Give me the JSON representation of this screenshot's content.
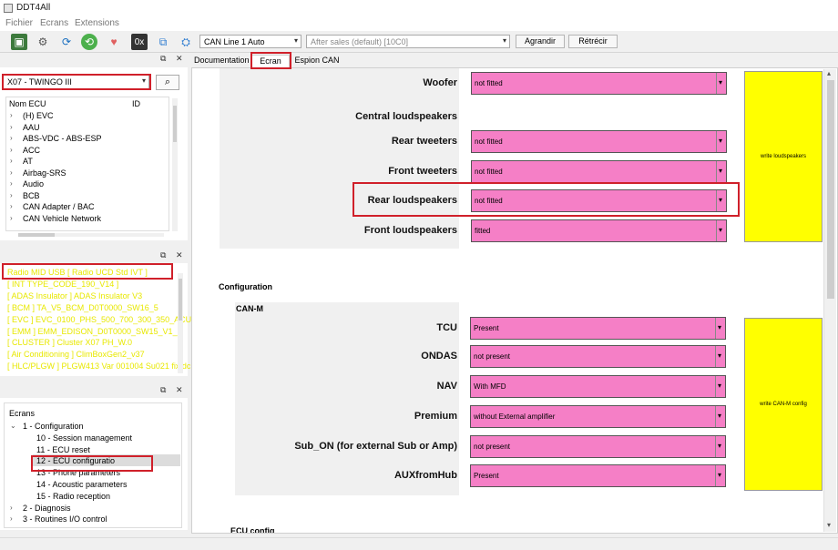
{
  "app": {
    "title": "DDT4All"
  },
  "menu": {
    "items": [
      "Fichier",
      "Ecrans",
      "Extensions"
    ]
  },
  "toolbar": {
    "can_line": "CAN Line 1 Auto",
    "session": "After sales (default) [10C0]",
    "zoom_in": "Agrandir",
    "zoom_out": "Rétrécir",
    "hex_label": "0x"
  },
  "vehicle": {
    "selected": "X07 - TWINGO III"
  },
  "ecu_list": {
    "col_name": "Nom ECU",
    "col_id": "ID",
    "items": [
      "(H) EVC",
      "AAU",
      "ABS-VDC - ABS-ESP",
      "ACC",
      "AT",
      "Airbag-SRS",
      "Audio",
      "BCB",
      "CAN Adapter / BAC",
      "CAN Vehicle Network"
    ]
  },
  "scanned": {
    "items": [
      "Radio MID USB [ Radio UCD Std IVT ]",
      "[ INT TYPE_CODE_190_V14 ]",
      "[ ADAS Insulator ] ADAS Insulator V3",
      "[ BCM ] TA_V5_BCM_D0T0000_SW16_5",
      "[ EVC ] EVC_0100_PHS_500_700_300_350_ACU_1",
      "[ EMM ] EMM_EDISON_D0T0000_SW15_V1_1",
      "[ CLUSTER ] Cluster X07 PH_W.0",
      "[ Air Conditioning ] ClimBoxGen2_v37",
      "[ HLC/PLGW ] PLGW413 Var 001004 Su021 fix dc"
    ]
  },
  "screens": {
    "header": "Ecrans",
    "groups": [
      {
        "label": "1 - Configuration",
        "children": [
          "10 - Session management",
          "11 - ECU reset",
          "12 - ECU configuratio",
          "13 - Phone parameters",
          "14 - Acoustic parameters",
          "15 - Radio reception"
        ]
      },
      {
        "label": "2 - Diagnosis"
      },
      {
        "label": "3 - Routines I/O control"
      }
    ]
  },
  "tabs": [
    "Documentation",
    "Ecran",
    "Espion CAN"
  ],
  "loudspeakers": {
    "rows": [
      {
        "label": "Woofer",
        "value": "not fitted"
      },
      {
        "label": "Central loudspeakers",
        "value": ""
      },
      {
        "label": "Rear tweeters",
        "value": "not fitted"
      },
      {
        "label": "Front tweeters",
        "value": "not fitted"
      },
      {
        "label": "Rear loudspeakers",
        "value": "not fitted"
      },
      {
        "label": "Front loudspeakers",
        "value": "fitted"
      }
    ],
    "write_button": "write loudspeakers"
  },
  "configuration": {
    "title": "Configuration",
    "canm_title": "CAN-M",
    "rows": [
      {
        "label": "TCU",
        "value": "Present"
      },
      {
        "label": "ONDAS",
        "value": "not present"
      },
      {
        "label": "NAV",
        "value": "With MFD"
      },
      {
        "label": "Premium",
        "value": "without External amplifier"
      },
      {
        "label": "Sub_ON (for external Sub or Amp)",
        "value": "not present"
      },
      {
        "label": "AUXfromHub",
        "value": "Present"
      }
    ],
    "write_button": "write CAN-M config",
    "next_section": "ECU config"
  },
  "colors": {
    "field": "#f57fc6",
    "write": "#ffff00",
    "highlight": "#d0202a",
    "scanned_text": "#e8e800"
  }
}
